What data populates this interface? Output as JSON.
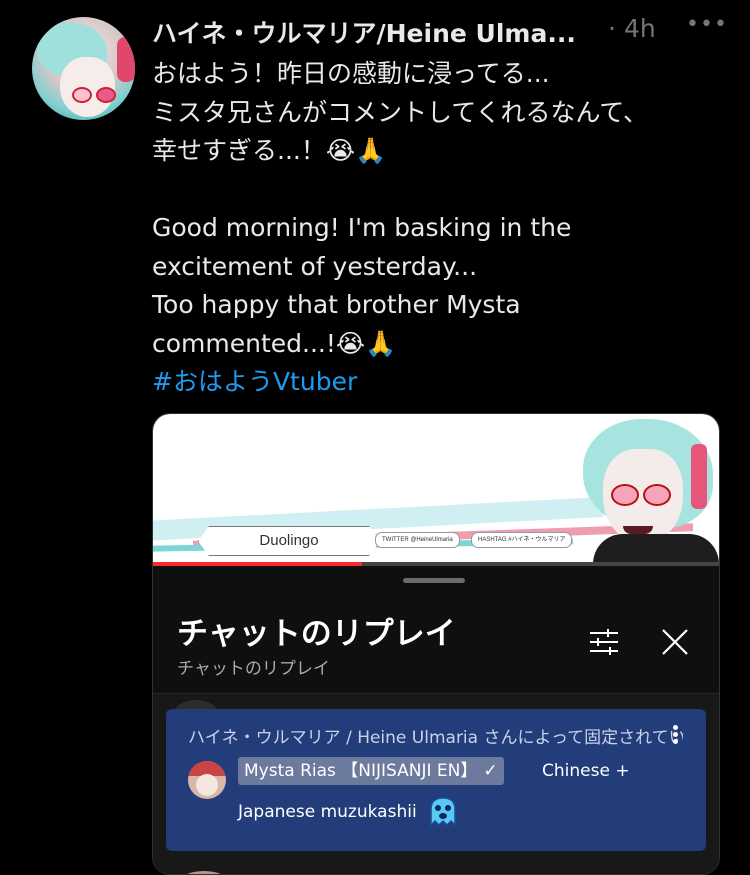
{
  "tweet": {
    "display_name": "ハイネ・ウルマリア/Heine Ulma...",
    "separator": "·",
    "time": "4h",
    "more": "•••",
    "lines_jp": [
      "おはよう！昨日の感動に浸ってる...",
      "ミスタ兄さんがコメントしてくれるなんて、",
      "幸せすぎる...！😭🙏"
    ],
    "lines_en": [
      "Good morning! I'm basking in the",
      "excitement of yesterday...",
      "Too happy that brother Mysta",
      "commented...!😭🙏"
    ],
    "hashtag": "#おはようVtuber"
  },
  "media": {
    "banner": {
      "pill_label": "Duolingo",
      "tag_twitter": "TWITTER @HeineUlmaria",
      "tag_hashtag": "HASHTAG #ハイネ・ウルマリア",
      "progress_fraction": 0.37
    },
    "chat_panel": {
      "title": "チャットのリプレイ",
      "subtitle": "チャットのリプレイ",
      "pinned": {
        "pinned_by": "ハイネ・ウルマリア / Heine Ulmaria さんによって固定されています",
        "author": "Mysta Rias 【NIJISANJI EN】",
        "verified_mark": "✓",
        "message_part1": "Chinese +",
        "message_part2": "Japanese muzukashii"
      }
    }
  },
  "colors": {
    "background": "#000000",
    "text": "#e7e9ea",
    "muted": "#71767b",
    "link": "#1d9bf0",
    "pinned_bg": "#233d7a",
    "progress": "#ff2b2b"
  }
}
